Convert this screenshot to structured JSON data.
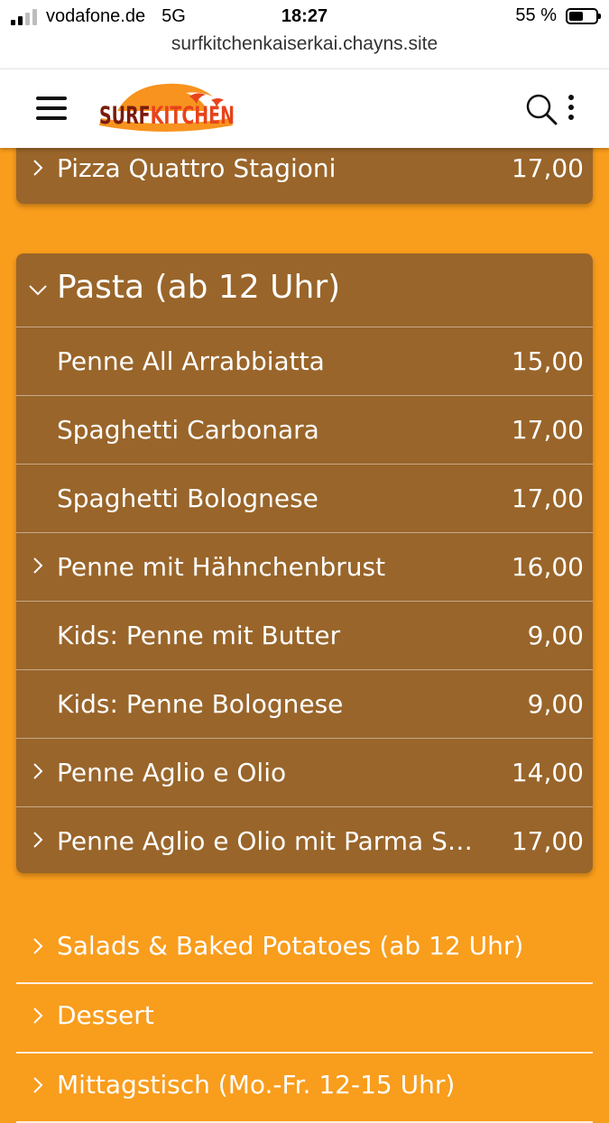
{
  "status_bar": {
    "carrier": "vodafone.de",
    "network": "5G",
    "time": "18:27",
    "battery": "55 %",
    "battery_level": 0.55
  },
  "browser": {
    "url": "surfkitchenkaiserkai.chayns.site"
  },
  "header": {
    "logo_text": "SURFKITCHEN",
    "logo_part1": "SURF",
    "logo_part2": "KITCHEN"
  },
  "prev_item": {
    "name": "Pizza Quattro Stagioni",
    "price": "17,00"
  },
  "pasta": {
    "title": "Pasta (ab 12 Uhr)",
    "items": [
      {
        "name": "Penne All Arrabbiatta",
        "price": "15,00",
        "expandable": false
      },
      {
        "name": "Spaghetti Carbonara",
        "price": "17,00",
        "expandable": false
      },
      {
        "name": "Spaghetti Bolognese",
        "price": "17,00",
        "expandable": false
      },
      {
        "name": "Penne mit Hähnchenbrust",
        "price": "16,00",
        "expandable": true
      },
      {
        "name": "Kids: Penne mit Butter",
        "price": "9,00",
        "expandable": false
      },
      {
        "name": "Kids: Penne Bolognese",
        "price": "9,00",
        "expandable": false
      },
      {
        "name": "Penne Aglio e Olio",
        "price": "14,00",
        "expandable": true
      },
      {
        "name": "Penne Aglio e Olio mit Parma Schinken",
        "price": "17,00",
        "expandable": true
      }
    ]
  },
  "categories": [
    {
      "name": "Salads & Baked Potatoes (ab 12 Uhr)"
    },
    {
      "name": "Dessert"
    },
    {
      "name": "Mittagstisch (Mo.-Fr. 12-15 Uhr)"
    }
  ],
  "colors": {
    "background": "#f99d1c",
    "card": "#99652a",
    "logo_dark": "#7a1c0c",
    "logo_accent": "#e8431b"
  }
}
